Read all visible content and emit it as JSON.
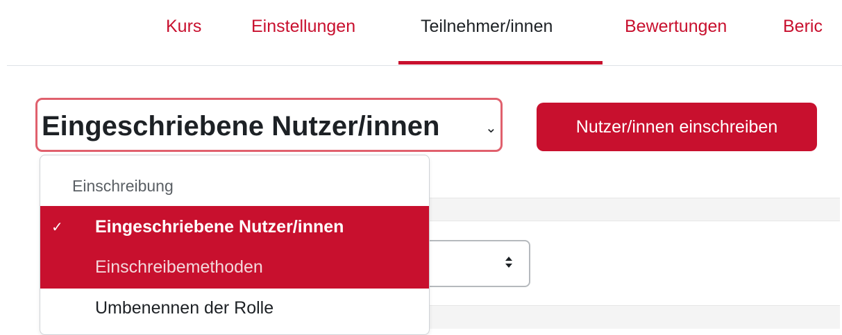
{
  "nav": {
    "items": [
      {
        "label": "Kurs"
      },
      {
        "label": "Einstellungen"
      },
      {
        "label": "Teilnehmer/innen"
      },
      {
        "label": "Bewertungen"
      },
      {
        "label": "Beric"
      }
    ],
    "active": "Teilnehmer/innen"
  },
  "tertiary": {
    "selected_label": "Eingeschriebene Nutzer/innen",
    "chevron_icon": "chevron-down-icon"
  },
  "actions": {
    "enrol_button": "Nutzer/innen einschreiben"
  },
  "menu": {
    "header": "Einschreibung",
    "items": [
      {
        "label": "Eingeschriebene Nutzer/innen",
        "checked": true
      },
      {
        "label": "Einschreibemethoden"
      },
      {
        "label": "Umbenennen der Rolle"
      }
    ],
    "check_icon": "check-icon"
  },
  "background_select": {
    "arrow_icon": "sort-arrows-icon"
  },
  "colors": {
    "brand": "#c8102e",
    "text": "#1d2125",
    "border": "#dee2e6"
  }
}
